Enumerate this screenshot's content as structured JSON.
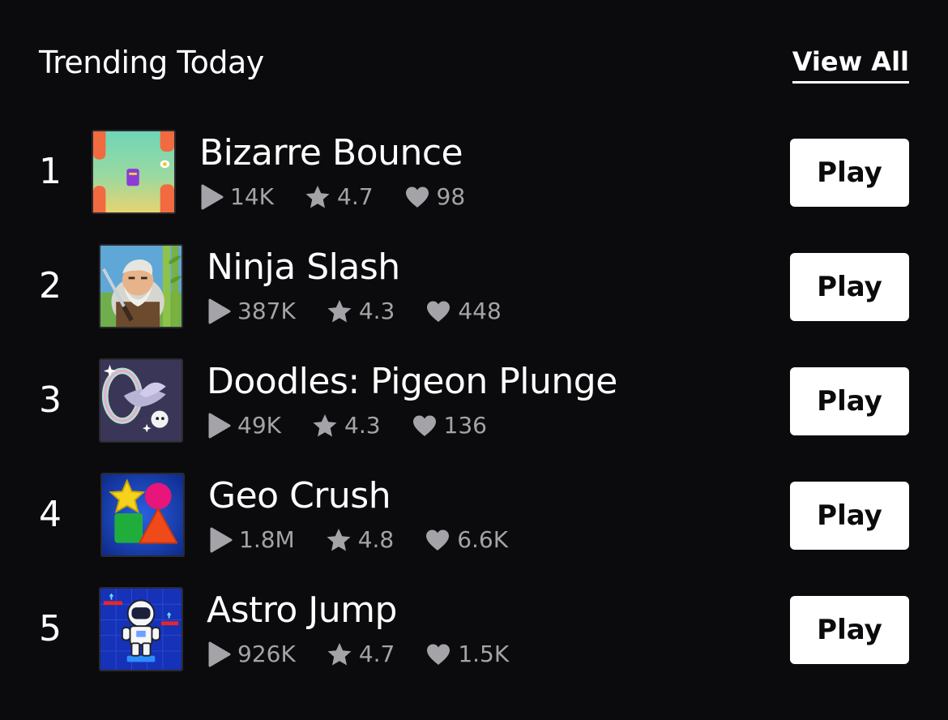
{
  "section": {
    "title": "Trending Today",
    "view_all_label": "View All"
  },
  "games": [
    {
      "rank": "1",
      "name": "Bizarre Bounce",
      "plays": "14K",
      "rating": "4.7",
      "likes": "98",
      "play_label": "Play",
      "thumbnail_icon": "bizarre-bounce-thumbnail"
    },
    {
      "rank": "2",
      "name": "Ninja Slash",
      "plays": "387K",
      "rating": "4.3",
      "likes": "448",
      "play_label": "Play",
      "thumbnail_icon": "ninja-slash-thumbnail"
    },
    {
      "rank": "3",
      "name": "Doodles: Pigeon Plunge",
      "plays": "49K",
      "rating": "4.3",
      "likes": "136",
      "play_label": "Play",
      "thumbnail_icon": "pigeon-plunge-thumbnail"
    },
    {
      "rank": "4",
      "name": "Geo Crush",
      "plays": "1.8M",
      "rating": "4.8",
      "likes": "6.6K",
      "play_label": "Play",
      "thumbnail_icon": "geo-crush-thumbnail"
    },
    {
      "rank": "5",
      "name": "Astro Jump",
      "plays": "926K",
      "rating": "4.7",
      "likes": "1.5K",
      "play_label": "Play",
      "thumbnail_icon": "astro-jump-thumbnail"
    }
  ],
  "colors": {
    "background": "#0b0b0d",
    "text": "#ffffff",
    "stat_text": "#a3a3a8",
    "button_bg": "#ffffff",
    "button_text": "#0b0b0d"
  }
}
